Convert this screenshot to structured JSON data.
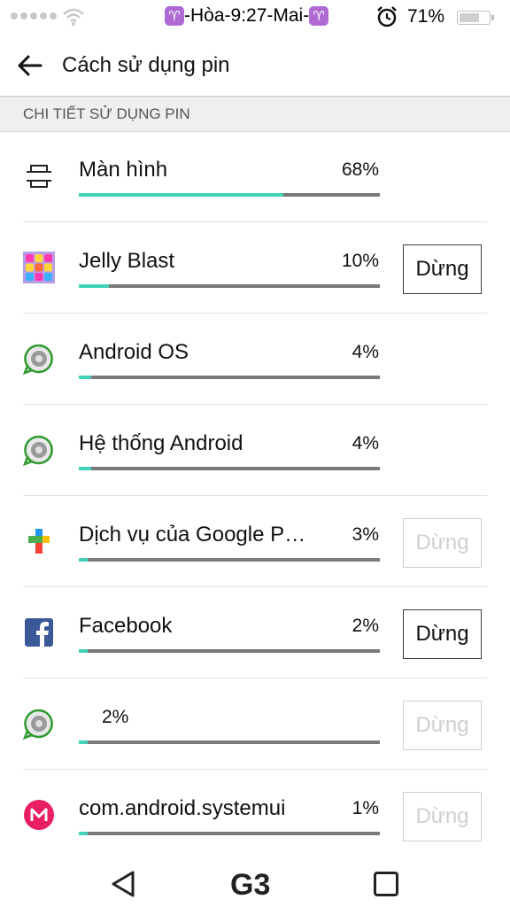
{
  "status_bar": {
    "title": "-Hòa-9:27-Mai-",
    "zodiac_symbol": "♈",
    "battery_percent": "71%",
    "battery_level": 0.71
  },
  "app_bar": {
    "title": "Cách sử dụng pin"
  },
  "section": {
    "label": "CHI TIẾT SỬ DỤNG PIN"
  },
  "colors": {
    "accent": "#3fd2b8",
    "bar_track": "#7a7a7a",
    "disabled": "#cfcfcf"
  },
  "items": [
    {
      "name": "Màn hình",
      "percent": "68%",
      "usage": 0.68,
      "icon": "screen-icon",
      "stop": null
    },
    {
      "name": "Jelly Blast",
      "percent": "10%",
      "usage": 0.1,
      "icon": "jelly-blast-icon",
      "stop": "Dừng",
      "stop_enabled": true
    },
    {
      "name": "Android OS",
      "percent": "4%",
      "usage": 0.04,
      "icon": "android-system-icon",
      "stop": null
    },
    {
      "name": "Hệ thống Android",
      "percent": "4%",
      "usage": 0.04,
      "icon": "android-system-icon",
      "stop": null
    },
    {
      "name": "Dịch vụ của Google P…",
      "percent": "3%",
      "usage": 0.03,
      "icon": "google-play-services-icon",
      "stop": "Dừng",
      "stop_enabled": false
    },
    {
      "name": "Facebook",
      "percent": "2%",
      "usage": 0.02,
      "icon": "facebook-icon",
      "stop": "Dừng",
      "stop_enabled": true
    },
    {
      "name": "",
      "percent": "2%",
      "usage": 0.02,
      "icon": "android-system-icon",
      "stop": "Dừng",
      "stop_enabled": false
    },
    {
      "name": "com.android.systemui",
      "percent": "1%",
      "usage": 0.01,
      "icon": "systemui-icon",
      "stop": "Dừng",
      "stop_enabled": false
    }
  ],
  "nav_bar": {
    "home_logo": "G3"
  }
}
